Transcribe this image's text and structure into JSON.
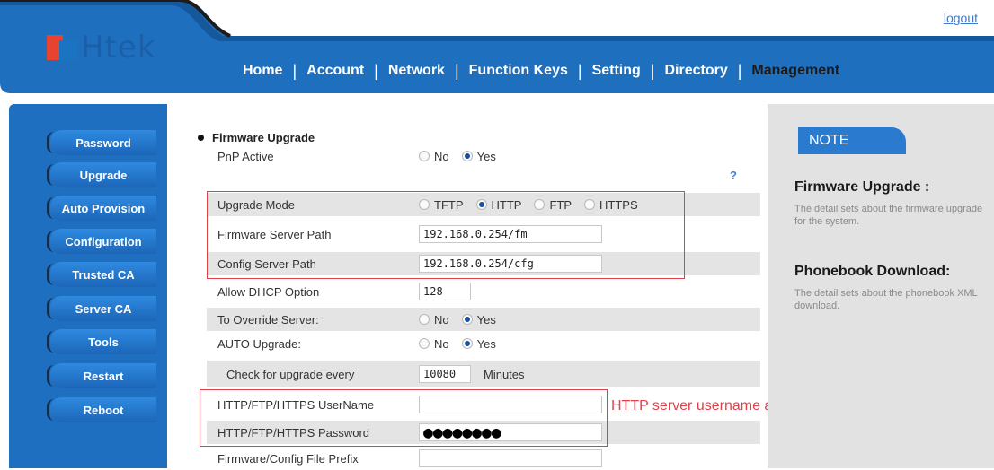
{
  "header": {
    "logo_text": "Htek",
    "logout": "logout",
    "nav": [
      "Home",
      "Account",
      "Network",
      "Function Keys",
      "Setting",
      "Directory",
      "Management"
    ],
    "nav_active": "Management",
    "colors": {
      "nav_bar": "#1f6fbf",
      "accent_red": "#e8432f",
      "brand_blue": "#1a74c2"
    }
  },
  "sidebar": {
    "items": [
      "Password",
      "Upgrade",
      "Auto Provision",
      "Configuration",
      "Trusted CA",
      "Server CA",
      "Tools",
      "Restart",
      "Reboot"
    ]
  },
  "main": {
    "section_title": "Firmware Upgrade",
    "help_icon": "?",
    "rows": {
      "pnp_active": {
        "label": "PnP Active",
        "opt_no": "No",
        "opt_yes": "Yes",
        "selected": "Yes"
      },
      "upgrade_mode": {
        "label": "Upgrade Mode",
        "opt1": "TFTP",
        "opt2": "HTTP",
        "opt3": "FTP",
        "opt4": "HTTPS",
        "selected": "HTTP"
      },
      "firmware_server_path": {
        "label": "Firmware Server Path",
        "value": "192.168.0.254/fm"
      },
      "config_server_path": {
        "label": "Config Server Path",
        "value": "192.168.0.254/cfg"
      },
      "allow_dhcp_option": {
        "label": "Allow DHCP Option",
        "value": "128"
      },
      "override_server": {
        "label": "To Override Server:",
        "opt_no": "No",
        "opt_yes": "Yes",
        "selected": "Yes"
      },
      "auto_upgrade": {
        "label": "AUTO Upgrade:",
        "opt_no": "No",
        "opt_yes": "Yes",
        "selected": "Yes"
      },
      "check_every": {
        "label": "Check for upgrade every",
        "value": "10080",
        "unit": "Minutes"
      },
      "username": {
        "label": "HTTP/FTP/HTTPS UserName",
        "value": ""
      },
      "password": {
        "label": "HTTP/FTP/HTTPS Password",
        "value": "●●●●●●●●"
      },
      "file_prefix": {
        "label": "Firmware/Config File Prefix",
        "value": ""
      }
    },
    "annotation": "HTTP server username and password"
  },
  "note": {
    "tab": "NOTE",
    "h1": "Firmware Upgrade :",
    "p1": "The detail sets about the firmware upgrade for the system.",
    "h2": "Phonebook Download:",
    "p2": "The detail sets about the phonebook XML download."
  }
}
